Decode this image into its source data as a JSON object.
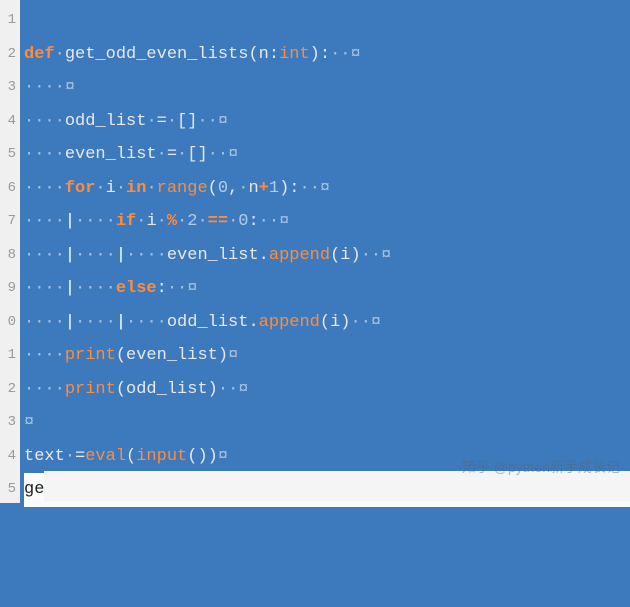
{
  "watermark": "知乎 @python新手成长记",
  "gutter": [
    "1",
    "2",
    "3",
    "4",
    "5",
    "6",
    "7",
    "8",
    "9",
    "0",
    "1",
    "2",
    "3",
    "4",
    "5"
  ],
  "tokens": {
    "def": "def",
    "for": "for",
    "in": "in",
    "if": "if",
    "else": "else",
    "int": "int",
    "range": "range",
    "print": "print",
    "append": "append",
    "eval": "eval",
    "input": "input",
    "fn_name": "get_odd_even_lists",
    "n": "n",
    "i": "i",
    "text": "text",
    "odd_list": "odd_list",
    "even_list": "even_list",
    "zero": "0",
    "one": "1",
    "two": "2",
    "dot": "·",
    "pm": "¤",
    "pipe": "|",
    "lp": "(",
    "rp": ")",
    "lb": "[",
    "rb": "]",
    "colon": ":",
    "comma": ",",
    "period": ".",
    "eq": "=",
    "eqeq": "==",
    "plus": "+",
    "mod": "%"
  }
}
